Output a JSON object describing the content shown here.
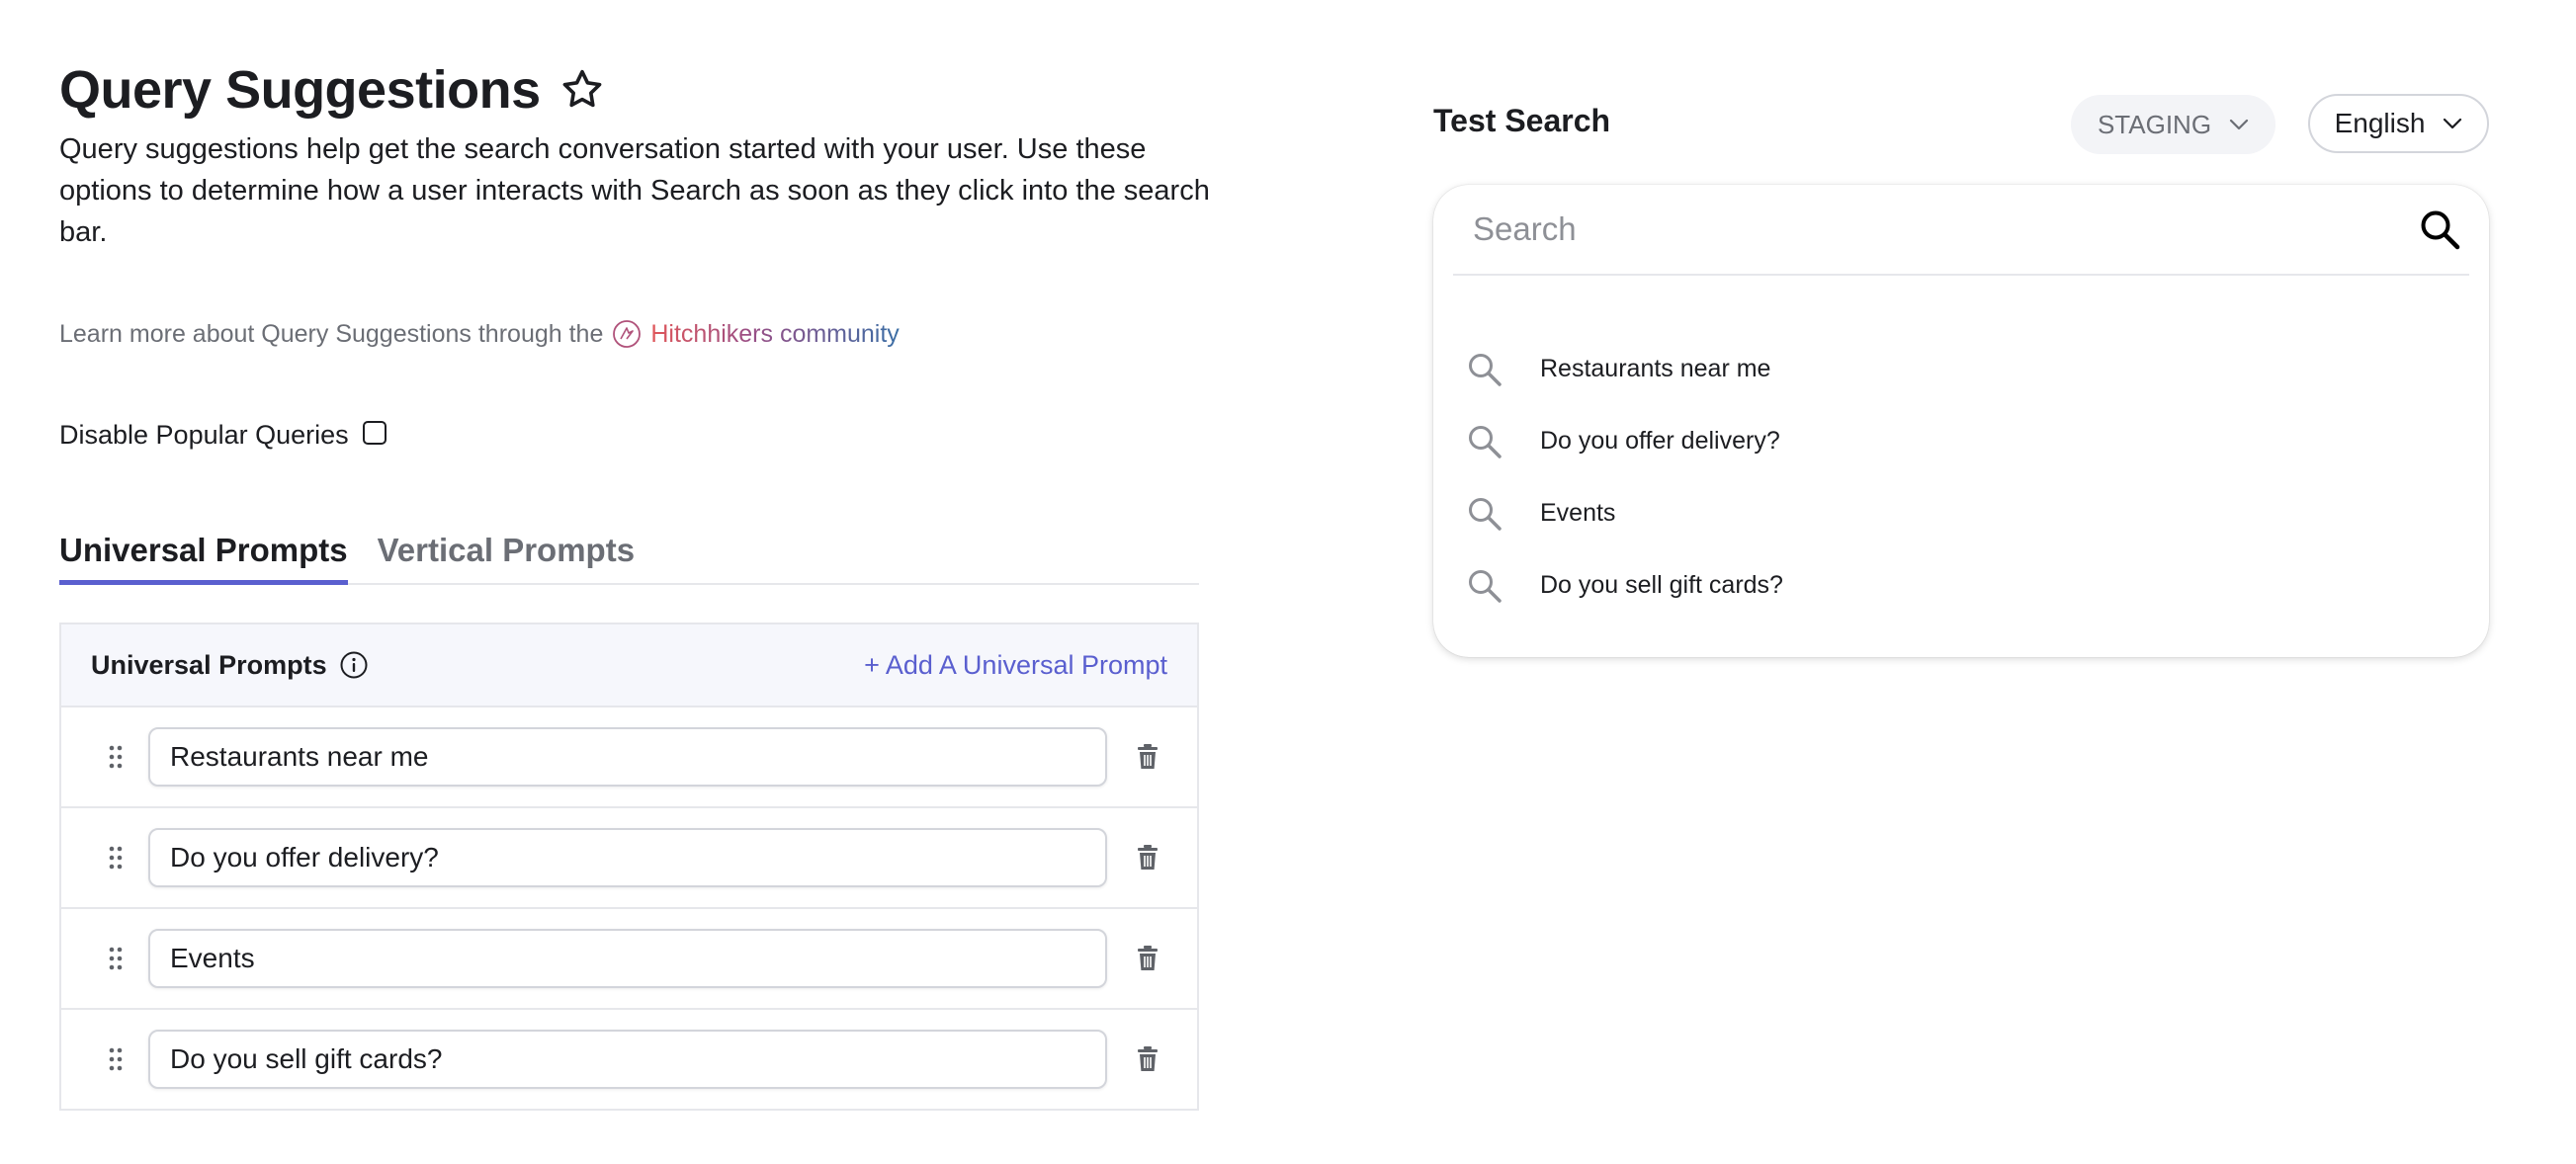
{
  "header": {
    "title": "Query Suggestions",
    "description": "Query suggestions help get the search conversation started with your user. Use these options to determine how a user interacts with Search as soon as they click into the search bar."
  },
  "learn_more": {
    "prefix": "Learn more about Query Suggestions through the",
    "link_text": "Hitchhikers community"
  },
  "disable_popular": {
    "label": "Disable Popular Queries",
    "checked": false
  },
  "tabs": [
    {
      "label": "Universal Prompts",
      "active": true
    },
    {
      "label": "Vertical Prompts",
      "active": false
    }
  ],
  "panel": {
    "title": "Universal Prompts",
    "add_label": "+ Add A Universal Prompt",
    "prompts": [
      "Restaurants near me",
      "Do you offer delivery?",
      "Events",
      "Do you sell gift cards?"
    ]
  },
  "test_search": {
    "title": "Test Search",
    "environment": "STAGING",
    "language": "English",
    "placeholder": "Search",
    "suggestions": [
      "Restaurants near me",
      "Do you offer delivery?",
      "Events",
      "Do you sell gift cards?"
    ]
  },
  "colors": {
    "accent": "#5a5fcf",
    "border": "#e6e7eb",
    "muted": "#6b6e75"
  }
}
